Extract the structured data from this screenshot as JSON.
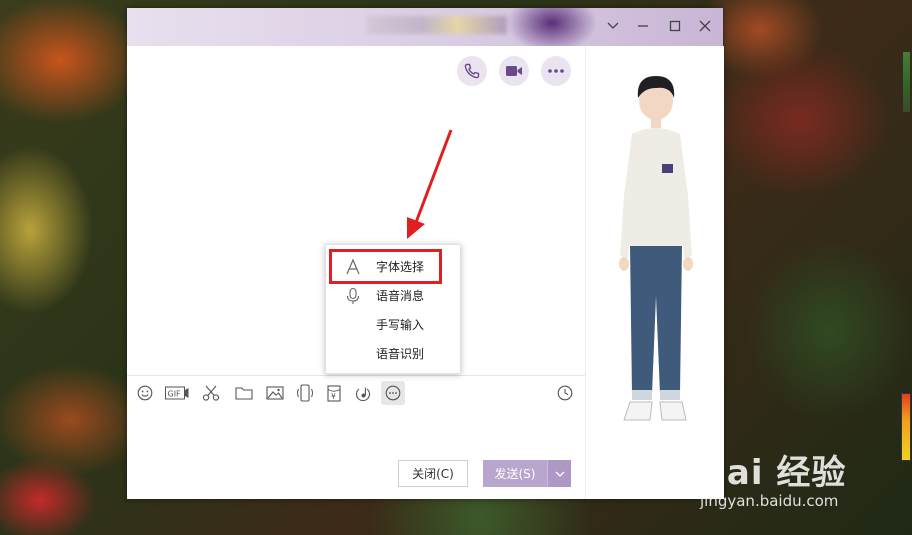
{
  "window": {
    "minimize_glyph": "—",
    "maximize_glyph": "□",
    "close_glyph": "✕",
    "dropdown_glyph": "⌵"
  },
  "chat_header": {
    "buttons": [
      {
        "name": "phone-call",
        "icon": "phone-icon"
      },
      {
        "name": "video-call",
        "icon": "video-camera-icon"
      },
      {
        "name": "more",
        "icon": "more-dots-icon"
      }
    ]
  },
  "toolbar": {
    "items": [
      {
        "name": "emoji",
        "icon": "smiley-icon"
      },
      {
        "name": "gif",
        "icon": "gif-icon",
        "text": "GIF"
      },
      {
        "name": "screenshot",
        "icon": "scissors-icon"
      },
      {
        "name": "file",
        "icon": "folder-icon"
      },
      {
        "name": "image",
        "icon": "image-icon"
      },
      {
        "name": "shake",
        "icon": "phone-shake-icon"
      },
      {
        "name": "red-packet",
        "icon": "red-packet-icon",
        "text": "¥"
      },
      {
        "name": "music",
        "icon": "music-icon"
      },
      {
        "name": "more-tools",
        "icon": "more-circle-icon"
      }
    ],
    "history_icon": "clock-icon"
  },
  "context_menu": {
    "items": [
      {
        "label": "字体选择",
        "icon": "font-a-icon"
      },
      {
        "label": "语音消息",
        "icon": "microphone-icon"
      },
      {
        "label": "手写输入",
        "icon": ""
      },
      {
        "label": "语音识别",
        "icon": ""
      }
    ]
  },
  "footer": {
    "close_label": "关闭(C)",
    "send_label": "发送(S)"
  },
  "watermark": {
    "main": "Bai 经验",
    "sub": "jingyan.baidu.com"
  },
  "colors": {
    "accent": "#b9a6cf",
    "highlight": "#e02020",
    "titlebar": "#d9cce3"
  }
}
